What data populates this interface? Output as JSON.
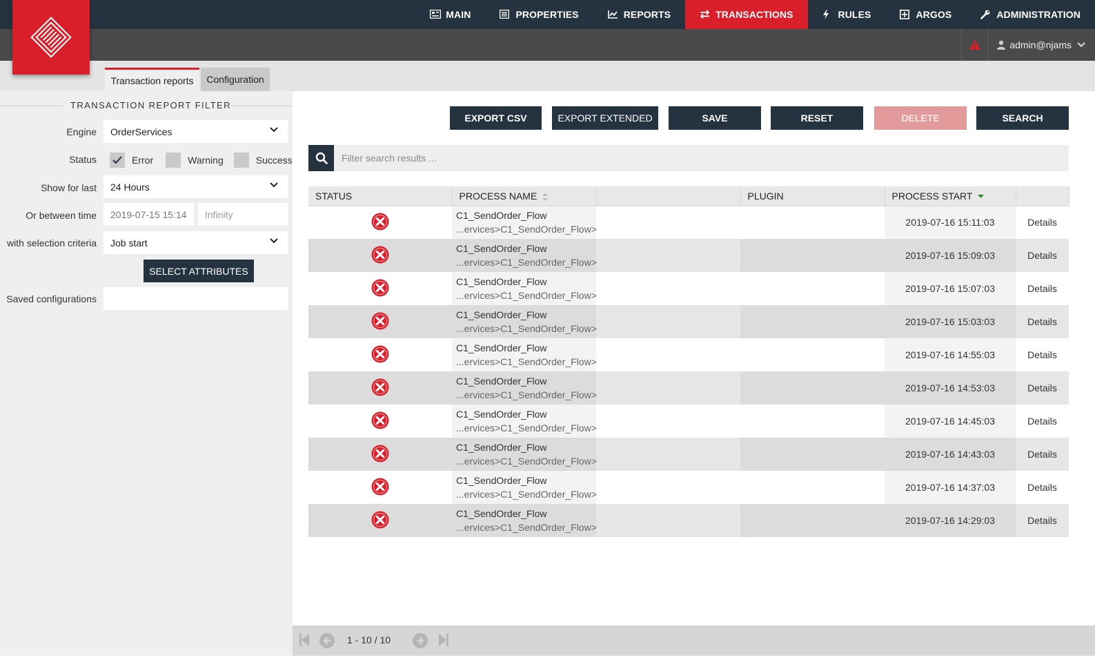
{
  "nav": {
    "items": [
      {
        "label": "MAIN",
        "icon": "dashboard-icon"
      },
      {
        "label": "PROPERTIES",
        "icon": "list-icon"
      },
      {
        "label": "REPORTS",
        "icon": "chart-icon"
      },
      {
        "label": "TRANSACTIONS",
        "icon": "transfer-icon",
        "active": true
      },
      {
        "label": "RULES",
        "icon": "bolt-icon"
      },
      {
        "label": "ARGOS",
        "icon": "plus-square-icon"
      },
      {
        "label": "ADMINISTRATION",
        "icon": "wrench-icon"
      }
    ],
    "user": "admin@njams"
  },
  "tabs": [
    "Transaction reports",
    "Configuration"
  ],
  "filter": {
    "title": "TRANSACTION REPORT FILTER",
    "engine_label": "Engine",
    "engine_value": "OrderServices",
    "status_label": "Status",
    "status_options": [
      {
        "label": "Error",
        "checked": true
      },
      {
        "label": "Warning",
        "checked": false
      },
      {
        "label": "Success",
        "checked": false
      }
    ],
    "showlast_label": "Show for last",
    "showlast_value": "24 Hours",
    "between_label": "Or between time",
    "between_from": "2019-07-15 15:14",
    "between_to": "Infinity",
    "criteria_label": "with selection criteria",
    "criteria_value": "Job start",
    "select_attributes": "SELECT ATTRIBUTES",
    "saved_label": "Saved configurations",
    "saved_value": ""
  },
  "toolbar": {
    "export_csv": "EXPORT CSV",
    "export_extended": "EXPORT EXTENDED",
    "save": "SAVE",
    "reset": "RESET",
    "delete": "DELETE",
    "search": "SEARCH"
  },
  "search": {
    "placeholder": "Filter search results ..."
  },
  "table": {
    "headers": [
      "STATUS",
      "PROCESS NAME",
      "",
      "PLUGIN",
      "PROCESS START",
      ""
    ],
    "rows": [
      {
        "name": "C1_SendOrder_Flow",
        "path": "...ervices>C1_SendOrder_Flow>",
        "start": "2019-07-16 15:11:03",
        "action": "Details"
      },
      {
        "name": "C1_SendOrder_Flow",
        "path": "...ervices>C1_SendOrder_Flow>",
        "start": "2019-07-16 15:09:03",
        "action": "Details"
      },
      {
        "name": "C1_SendOrder_Flow",
        "path": "...ervices>C1_SendOrder_Flow>",
        "start": "2019-07-16 15:07:03",
        "action": "Details"
      },
      {
        "name": "C1_SendOrder_Flow",
        "path": "...ervices>C1_SendOrder_Flow>",
        "start": "2019-07-16 15:03:03",
        "action": "Details"
      },
      {
        "name": "C1_SendOrder_Flow",
        "path": "...ervices>C1_SendOrder_Flow>",
        "start": "2019-07-16 14:55:03",
        "action": "Details"
      },
      {
        "name": "C1_SendOrder_Flow",
        "path": "...ervices>C1_SendOrder_Flow>",
        "start": "2019-07-16 14:53:03",
        "action": "Details"
      },
      {
        "name": "C1_SendOrder_Flow",
        "path": "...ervices>C1_SendOrder_Flow>",
        "start": "2019-07-16 14:45:03",
        "action": "Details"
      },
      {
        "name": "C1_SendOrder_Flow",
        "path": "...ervices>C1_SendOrder_Flow>",
        "start": "2019-07-16 14:43:03",
        "action": "Details"
      },
      {
        "name": "C1_SendOrder_Flow",
        "path": "...ervices>C1_SendOrder_Flow>",
        "start": "2019-07-16 14:37:03",
        "action": "Details"
      },
      {
        "name": "C1_SendOrder_Flow",
        "path": "...ervices>C1_SendOrder_Flow>",
        "start": "2019-07-16 14:29:03",
        "action": "Details"
      }
    ]
  },
  "pager": {
    "range": "1 - 10 / 10"
  },
  "colors": {
    "accent": "#d9202a",
    "dark": "#253341",
    "error": "#d9202a"
  }
}
